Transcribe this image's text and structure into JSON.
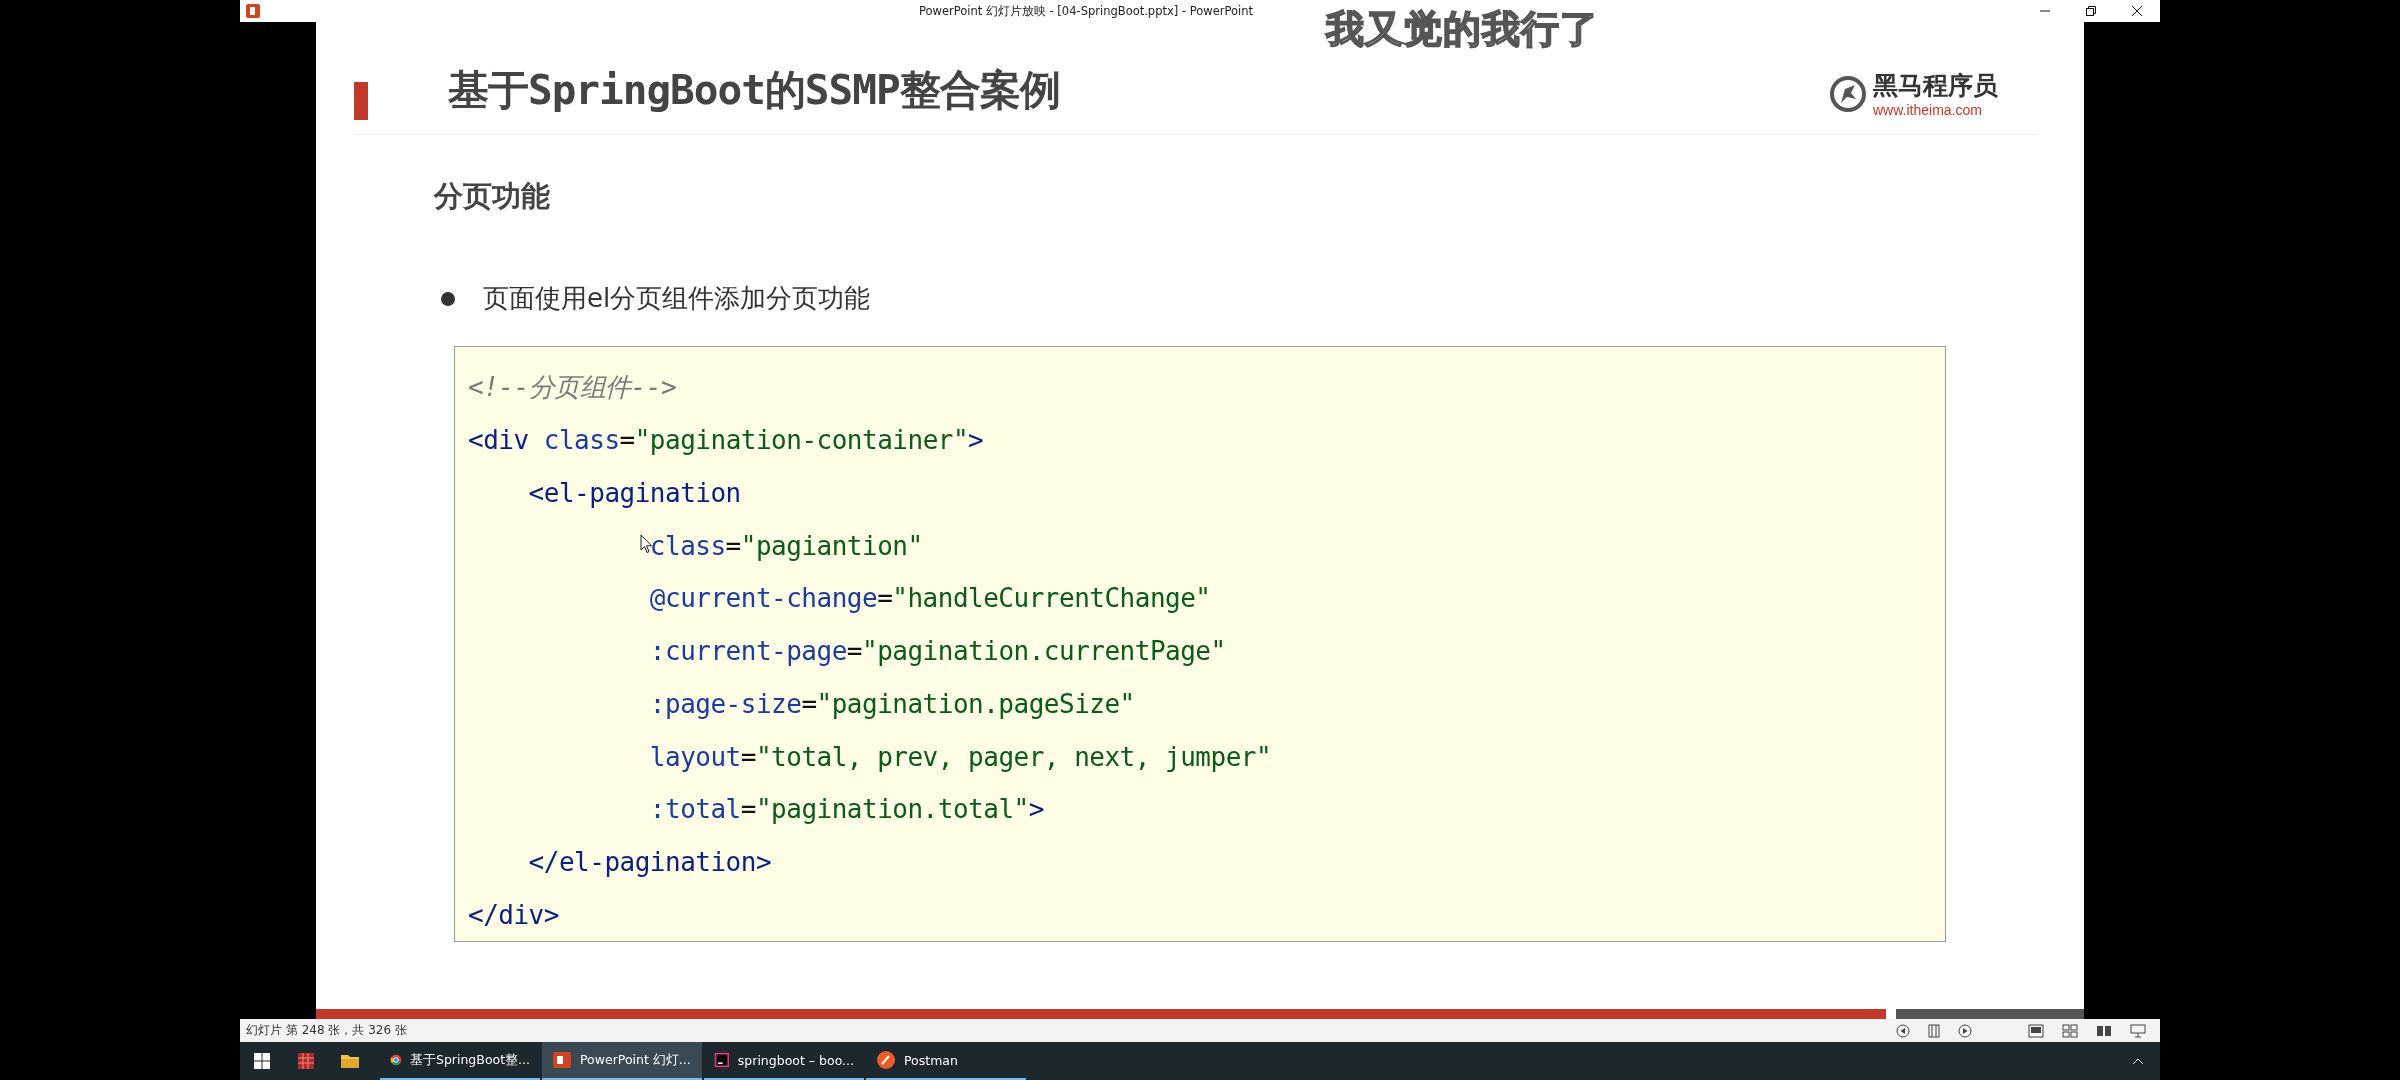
{
  "window": {
    "title": "PowerPoint 幻灯片放映 - [04-SpringBoot.pptx] - PowerPoint"
  },
  "subtitle": "我又觉的我行了",
  "slide": {
    "title": "基于SpringBoot的SSMP整合案例",
    "logo": {
      "name": "黑马程序员",
      "url": "www.itheima.com"
    },
    "heading": "分页功能",
    "bullets": [
      "页面使用el分页组件添加分页功能"
    ],
    "code": [
      {
        "tokens": [
          {
            "kind": "comment",
            "text": "<!--分页组件-->"
          }
        ]
      },
      {
        "tokens": [
          {
            "kind": "tag",
            "text": "<div "
          },
          {
            "kind": "attr",
            "text": "class"
          },
          {
            "kind": "punct",
            "text": "="
          },
          {
            "kind": "str",
            "text": "\"pagination-container\""
          },
          {
            "kind": "tag",
            "text": ">"
          }
        ]
      },
      {
        "tokens": [
          {
            "kind": "tag",
            "text": "    <el-pagination"
          }
        ]
      },
      {
        "pointer": true,
        "tokens": [
          {
            "kind": "attr",
            "text": "            class"
          },
          {
            "kind": "punct",
            "text": "="
          },
          {
            "kind": "str",
            "text": "\"pagiantion\""
          }
        ]
      },
      {
        "tokens": [
          {
            "kind": "attr",
            "text": "            @current-change"
          },
          {
            "kind": "punct",
            "text": "="
          },
          {
            "kind": "str",
            "text": "\"handleCurrentChange\""
          }
        ]
      },
      {
        "tokens": [
          {
            "kind": "attr",
            "text": "            :current-page"
          },
          {
            "kind": "punct",
            "text": "="
          },
          {
            "kind": "str",
            "text": "\"pagination.currentPage\""
          }
        ]
      },
      {
        "tokens": [
          {
            "kind": "attr",
            "text": "            :page-size"
          },
          {
            "kind": "punct",
            "text": "="
          },
          {
            "kind": "str",
            "text": "\"pagination.pageSize\""
          }
        ]
      },
      {
        "tokens": [
          {
            "kind": "attr",
            "text": "            layout"
          },
          {
            "kind": "punct",
            "text": "="
          },
          {
            "kind": "str",
            "text": "\"total, prev, pager, next, jumper\""
          }
        ]
      },
      {
        "tokens": [
          {
            "kind": "attr",
            "text": "            :total"
          },
          {
            "kind": "punct",
            "text": "="
          },
          {
            "kind": "str",
            "text": "\"pagination.total\""
          },
          {
            "kind": "tag",
            "text": ">"
          }
        ]
      },
      {
        "tokens": [
          {
            "kind": "tag",
            "text": "    </el-pagination>"
          }
        ]
      },
      {
        "tokens": [
          {
            "kind": "tag",
            "text": "</div>"
          }
        ]
      }
    ]
  },
  "status_bar": {
    "text": "幻灯片 第 248 张，共 326 张"
  },
  "taskbar": {
    "tasks": [
      {
        "kind": "browser",
        "label": "基于SpringBoot整...",
        "selected": false
      },
      {
        "kind": "slides",
        "label": "PowerPoint 幻灯...",
        "selected": true
      },
      {
        "kind": "ide",
        "label": "springboot – boo...",
        "selected": false
      },
      {
        "kind": "api",
        "label": "Postman",
        "selected": false
      }
    ]
  }
}
